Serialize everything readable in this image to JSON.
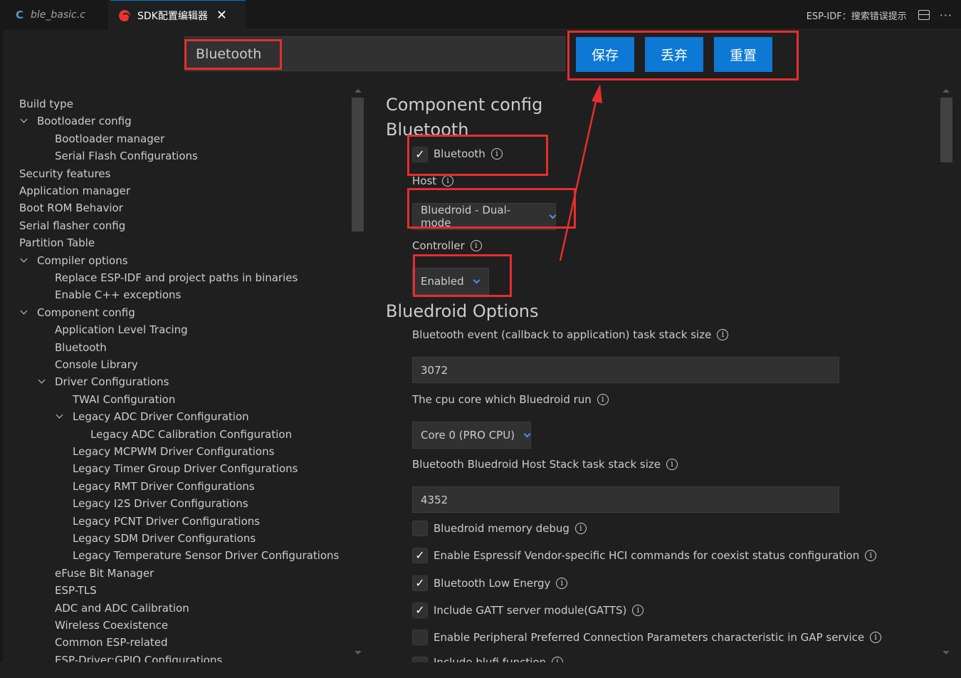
{
  "tabs": [
    {
      "icon": "C",
      "label": "ble_basic.c"
    },
    {
      "label": "SDK配置编辑器",
      "close": "✕"
    }
  ],
  "titlebar_right": {
    "hint": "ESP-IDF：搜索错误提示"
  },
  "search": {
    "value": "Bluetooth"
  },
  "actions": {
    "save": "保存",
    "discard": "丢弃",
    "reset": "重置"
  },
  "tree": [
    "Build type",
    "Bootloader config",
    "Bootloader manager",
    "Serial Flash Configurations",
    "Security features",
    "Application manager",
    "Boot ROM Behavior",
    "Serial flasher config",
    "Partition Table",
    "Compiler options",
    "Replace ESP-IDF and project paths in binaries",
    "Enable C++ exceptions",
    "Component config",
    "Application Level Tracing",
    "Bluetooth",
    "Console Library",
    "Driver Configurations",
    "TWAI Configuration",
    "Legacy ADC Driver Configuration",
    "Legacy ADC Calibration Configuration",
    "Legacy MCPWM Driver Configurations",
    "Legacy Timer Group Driver Configurations",
    "Legacy RMT Driver Configurations",
    "Legacy I2S Driver Configurations",
    "Legacy PCNT Driver Configurations",
    "Legacy SDM Driver Configurations",
    "Legacy Temperature Sensor Driver Configurations",
    "eFuse Bit Manager",
    "ESP-TLS",
    "ADC and ADC Calibration",
    "Wireless Coexistence",
    "Common ESP-related",
    "ESP-Driver:GPIO Configurations"
  ],
  "main": {
    "heading1": "Component config",
    "heading2": "Bluetooth",
    "bluetooth_label": "Bluetooth",
    "host_label": "Host",
    "host_value": "Bluedroid - Dual-mode",
    "controller_label": "Controller",
    "controller_value": "Enabled",
    "heading3": "Bluedroid Options",
    "event_stack_label": "Bluetooth event (callback to application) task stack size",
    "event_stack_value": "3072",
    "cpu_core_label": "The cpu core which Bluedroid run",
    "cpu_core_value": "Core 0 (PRO CPU)",
    "host_stack_label": "Bluetooth Bluedroid Host Stack task stack size",
    "host_stack_value": "4352",
    "opt_memdebug": "Bluedroid memory debug",
    "opt_vendor_hci": "Enable Espressif Vendor-specific HCI commands for coexist status configuration",
    "opt_ble": "Bluetooth Low Energy",
    "opt_gatts": "Include GATT server module(GATTS)",
    "opt_ppcp": "Enable Peripheral Preferred Connection Parameters characteristic in GAP service",
    "opt_blufi": "Include blufi function"
  },
  "checkmark": "✓",
  "info_glyph": "i"
}
